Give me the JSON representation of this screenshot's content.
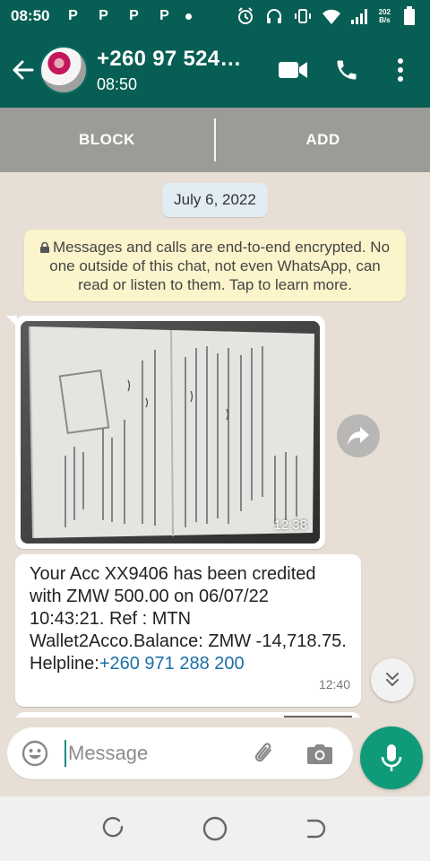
{
  "status_bar": {
    "time": "08:50",
    "notif_icons": [
      "P",
      "P",
      "P",
      "P"
    ],
    "net_speed_top": "202",
    "net_speed_bottom": "B/s",
    "icons": [
      "alarm-icon",
      "headset-icon",
      "vibrate-icon",
      "wifi-icon",
      "signal-icon",
      "battery-icon"
    ]
  },
  "header": {
    "title": "+260 97 524…",
    "subtitle": "08:50",
    "colors": {
      "bar": "#075e54"
    }
  },
  "block_bar": {
    "block_label": "BLOCK",
    "add_label": "ADD"
  },
  "chat": {
    "date_chip": "July 6, 2022",
    "encryption_note": "Messages and calls are end-to-end encrypted. No one outside of this chat, not even WhatsApp, can read or listen to them. Tap to learn more.",
    "image_message": {
      "time": "12:38"
    },
    "text_message": {
      "body": "Your Acc XX9406 has been credited with ZMW 500.00 on 06/07/22 10:43:21. Ref : MTN Wallet2Acco.Balance: ZMW -14,718.75. Helpline:",
      "link": "+260 971 288 200",
      "time": "12:40"
    }
  },
  "composer": {
    "placeholder": "Message"
  },
  "colors": {
    "accent": "#0f9b79",
    "chat_bg": "#e7dfd6",
    "note_bg": "#fcf4cb",
    "link": "#1b6fa8"
  }
}
